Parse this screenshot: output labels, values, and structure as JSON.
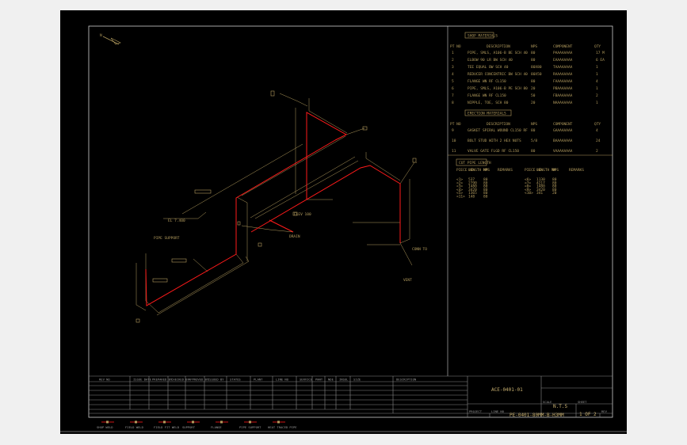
{
  "colors": {
    "background": "#000000",
    "frame": "#bdbdbd",
    "annotation": "#b39c5e",
    "pipe": "#ff1a1a",
    "grid": "#8a8a8a"
  },
  "north_arrow": {
    "label": "N"
  },
  "shop_materials": {
    "title": "SHOP MATERIALS",
    "headers": [
      "PT NO",
      "DESCRIPTION",
      "NPS",
      "COMPONENT",
      "QTY"
    ],
    "rows": [
      [
        "1",
        "PIPE, SMLS, A106-B BE SCH 40",
        "80",
        "PAAAAAAAA",
        "17 M"
      ],
      [
        "2",
        "ELBOW 90 LR BW SCH 40",
        "80",
        "EAAAAAAAA",
        "6 EA"
      ],
      [
        "3",
        "TEE EQUAL BW SCH 40",
        "80X80",
        "TAAAAAAAA",
        "1"
      ],
      [
        "4",
        "REDUCER CONCENTRIC BW SCH 40",
        "80X50",
        "RAAAAAAAA",
        "1"
      ],
      [
        "5",
        "FLANGE WN RF CL150",
        "80",
        "FAAAAAAAA",
        "4"
      ],
      [
        "6",
        "PIPE, SMLS, A106-B PE SCH 80",
        "20",
        "PBAAAAAAA",
        "1"
      ],
      [
        "7",
        "FLANGE WN RF CL150",
        "50",
        "FBAAAAAAA",
        "2"
      ],
      [
        "8",
        "NIPPLE, TOE, SCH 80",
        "20",
        "NAAAAAAAA",
        "1"
      ]
    ]
  },
  "erection_materials": {
    "title": "ERECTION MATERIALS",
    "headers": [
      "PT NO",
      "DESCRIPTION",
      "NPS",
      "COMPONENT",
      "QTY"
    ],
    "rows": [
      [
        "9",
        "GASKET SPIRAL WOUND CL150 RF",
        "80",
        "GAAAAAAAA",
        "4"
      ],
      [
        "10",
        "BOLT STUD WITH 2 HEX NUTS",
        "5/8",
        "BAAAAAAAA",
        "24"
      ],
      [
        "11",
        "VALVE GATE FLGD RF CL150",
        "80",
        "VAAAAAAAA",
        "2"
      ]
    ]
  },
  "cut_pipe_length": {
    "title": "CUT PIPE LENGTH",
    "headers": [
      "PIECE NO",
      "LENGTH MM",
      "NPS",
      "REMARKS",
      "PIECE NO",
      "LENGTH MM",
      "NPS",
      "REMARKS"
    ],
    "rows": [
      [
        "<1>",
        "537",
        "80",
        "",
        "<6>",
        "1130",
        "80",
        ""
      ],
      [
        "<2>",
        "2790",
        "80",
        "",
        "<7>",
        "4217",
        "80",
        ""
      ],
      [
        "<3>",
        "1480",
        "80",
        "",
        "<8>",
        "1480",
        "80",
        ""
      ],
      [
        "<4>",
        "3420",
        "80",
        "",
        "<9>",
        "3420",
        "80",
        ""
      ],
      [
        "<5>",
        "1365",
        "80",
        "",
        "<10>",
        "341",
        "20",
        ""
      ],
      [
        "<11>",
        "148",
        "80",
        "",
        "",
        "",
        "",
        ""
      ]
    ]
  },
  "revision_table": {
    "headers": [
      "REV NO",
      "ISSUE DATE",
      "PREPARED BY",
      "CHECKED BY",
      "APPROVED BY",
      "ISSUED BY",
      "STATUS",
      "PLANT",
      "LINE NO",
      "SERVICE",
      "PWHT",
      "NDE",
      "INSUL",
      "SIZE",
      "DESCRIPTION"
    ]
  },
  "legend": [
    "SHOP WELD",
    "FIELD WELD",
    "FIELD FIT WELD",
    "SUPPORT",
    "FLANGE",
    "PIPE SUPPORT",
    "HEAT TRACED PIPE"
  ],
  "title_block": {
    "drawing_title": "ACE-0401-01",
    "scale_label": "SCALE",
    "scale": "N.T.S",
    "sheet_label": "SHEET",
    "sheet": "1 OF 2",
    "project_label": "PROJECT",
    "line_label": "LINE NO",
    "line_no": "PE-0401-80MM-B-H3MM",
    "rev_label": "REV"
  },
  "labels": {
    "coords": [
      "ELEV 100",
      "EL 7.400",
      "CONN TO",
      "PIPE SUPPORT",
      "DRAIN",
      "VENT"
    ]
  }
}
